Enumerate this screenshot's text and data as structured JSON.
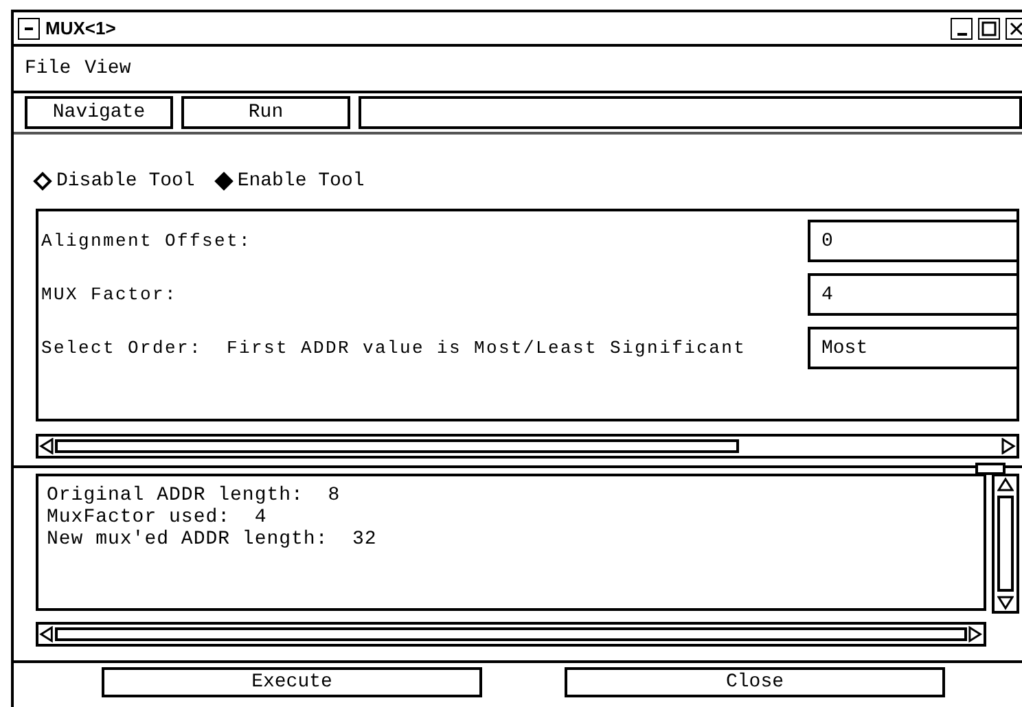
{
  "window": {
    "title": "MUX<1>"
  },
  "menu": [
    "File",
    "View"
  ],
  "toolbar": {
    "buttons": [
      "Navigate",
      "Run"
    ]
  },
  "mode_options": [
    {
      "label": "Disable Tool",
      "selected": false
    },
    {
      "label": "Enable Tool",
      "selected": true
    }
  ],
  "settings": [
    {
      "label": "Alignment Offset:",
      "value": "0"
    },
    {
      "label": "MUX Factor:",
      "value": "4"
    },
    {
      "label": "Select Order:  First ADDR value is Most/Least Significant",
      "value": "Most"
    }
  ],
  "output": {
    "lines": [
      "Original ADDR length:  8",
      "MuxFactor used:  4",
      "New mux'ed ADDR length:  32"
    ]
  },
  "buttons": [
    "Execute",
    "Close"
  ]
}
